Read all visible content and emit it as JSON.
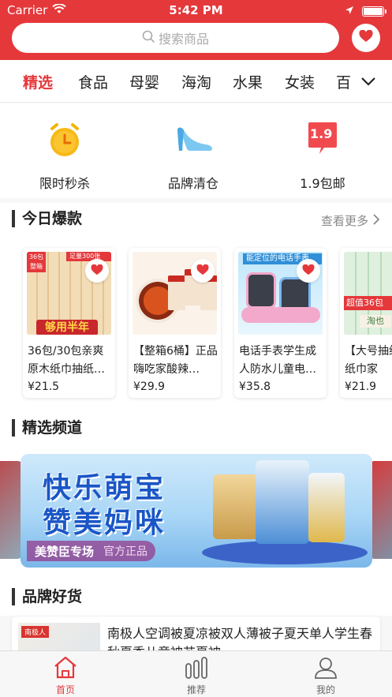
{
  "status": {
    "carrier": "Carrier",
    "time": "5:42 PM"
  },
  "search": {
    "placeholder": "搜索商品"
  },
  "category_tabs": [
    "精选",
    "食品",
    "母婴",
    "海淘",
    "水果",
    "女装",
    "百"
  ],
  "quick_links": [
    {
      "label": "限时秒杀",
      "icon": "alarm-clock-icon"
    },
    {
      "label": "品牌清仓",
      "icon": "high-heel-icon"
    },
    {
      "label": "1.9包邮",
      "icon": "price-tag-icon",
      "badge": "1.9"
    }
  ],
  "hot_section": {
    "title": "今日爆款",
    "more": "查看更多"
  },
  "hot_products": [
    {
      "title": "36包/30包亲爽原木纸巾抽纸…",
      "price": "¥21.5",
      "badge": "36包整箱",
      "overlay_top": "足量300张",
      "overlay_bottom": "够用半年"
    },
    {
      "title": "【整箱6桶】正品嗨吃家酸辣…",
      "price": "¥29.9"
    },
    {
      "title": "电话手表学生成人防水儿童电…",
      "price": "¥35.8",
      "overlay_top": "能定位的电话手表"
    },
    {
      "title": "【大号抽纸】也纸巾家",
      "price": "¥21.9",
      "overlay": "超值36包",
      "overlay_bottom": "淘也"
    }
  ],
  "channel_section": {
    "title": "精选频道"
  },
  "banner": {
    "line1": "快乐萌宝",
    "line2": "赞美妈咪",
    "tag": "美赞臣专场",
    "tag_sub": "官方正品"
  },
  "brand_section": {
    "title": "品牌好货"
  },
  "brand_item": {
    "title": "南极人空调被夏凉被双人薄被子夏天单人学生春秋夏季儿童被芯夏被",
    "logo_text": "南极人"
  },
  "tab_bar": [
    {
      "label": "首页",
      "icon": "home-icon",
      "active": true
    },
    {
      "label": "推荐",
      "icon": "bars-icon",
      "active": false
    },
    {
      "label": "我的",
      "icon": "user-icon",
      "active": false
    }
  ],
  "colors": {
    "brand": "#e5383b",
    "text": "#222222",
    "muted": "#888888"
  }
}
